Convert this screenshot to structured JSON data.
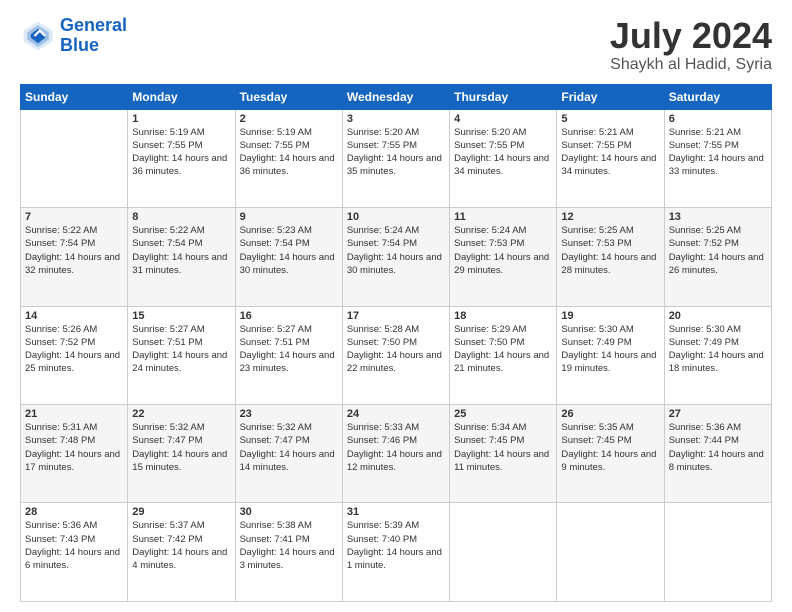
{
  "header": {
    "logo_line1": "General",
    "logo_line2": "Blue",
    "main_title": "July 2024",
    "subtitle": "Shaykh al Hadid, Syria"
  },
  "calendar": {
    "headers": [
      "Sunday",
      "Monday",
      "Tuesday",
      "Wednesday",
      "Thursday",
      "Friday",
      "Saturday"
    ],
    "weeks": [
      [
        {
          "day": "",
          "sunrise": "",
          "sunset": "",
          "daylight": ""
        },
        {
          "day": "1",
          "sunrise": "Sunrise: 5:19 AM",
          "sunset": "Sunset: 7:55 PM",
          "daylight": "Daylight: 14 hours and 36 minutes."
        },
        {
          "day": "2",
          "sunrise": "Sunrise: 5:19 AM",
          "sunset": "Sunset: 7:55 PM",
          "daylight": "Daylight: 14 hours and 36 minutes."
        },
        {
          "day": "3",
          "sunrise": "Sunrise: 5:20 AM",
          "sunset": "Sunset: 7:55 PM",
          "daylight": "Daylight: 14 hours and 35 minutes."
        },
        {
          "day": "4",
          "sunrise": "Sunrise: 5:20 AM",
          "sunset": "Sunset: 7:55 PM",
          "daylight": "Daylight: 14 hours and 34 minutes."
        },
        {
          "day": "5",
          "sunrise": "Sunrise: 5:21 AM",
          "sunset": "Sunset: 7:55 PM",
          "daylight": "Daylight: 14 hours and 34 minutes."
        },
        {
          "day": "6",
          "sunrise": "Sunrise: 5:21 AM",
          "sunset": "Sunset: 7:55 PM",
          "daylight": "Daylight: 14 hours and 33 minutes."
        }
      ],
      [
        {
          "day": "7",
          "sunrise": "Sunrise: 5:22 AM",
          "sunset": "Sunset: 7:54 PM",
          "daylight": "Daylight: 14 hours and 32 minutes."
        },
        {
          "day": "8",
          "sunrise": "Sunrise: 5:22 AM",
          "sunset": "Sunset: 7:54 PM",
          "daylight": "Daylight: 14 hours and 31 minutes."
        },
        {
          "day": "9",
          "sunrise": "Sunrise: 5:23 AM",
          "sunset": "Sunset: 7:54 PM",
          "daylight": "Daylight: 14 hours and 30 minutes."
        },
        {
          "day": "10",
          "sunrise": "Sunrise: 5:24 AM",
          "sunset": "Sunset: 7:54 PM",
          "daylight": "Daylight: 14 hours and 30 minutes."
        },
        {
          "day": "11",
          "sunrise": "Sunrise: 5:24 AM",
          "sunset": "Sunset: 7:53 PM",
          "daylight": "Daylight: 14 hours and 29 minutes."
        },
        {
          "day": "12",
          "sunrise": "Sunrise: 5:25 AM",
          "sunset": "Sunset: 7:53 PM",
          "daylight": "Daylight: 14 hours and 28 minutes."
        },
        {
          "day": "13",
          "sunrise": "Sunrise: 5:25 AM",
          "sunset": "Sunset: 7:52 PM",
          "daylight": "Daylight: 14 hours and 26 minutes."
        }
      ],
      [
        {
          "day": "14",
          "sunrise": "Sunrise: 5:26 AM",
          "sunset": "Sunset: 7:52 PM",
          "daylight": "Daylight: 14 hours and 25 minutes."
        },
        {
          "day": "15",
          "sunrise": "Sunrise: 5:27 AM",
          "sunset": "Sunset: 7:51 PM",
          "daylight": "Daylight: 14 hours and 24 minutes."
        },
        {
          "day": "16",
          "sunrise": "Sunrise: 5:27 AM",
          "sunset": "Sunset: 7:51 PM",
          "daylight": "Daylight: 14 hours and 23 minutes."
        },
        {
          "day": "17",
          "sunrise": "Sunrise: 5:28 AM",
          "sunset": "Sunset: 7:50 PM",
          "daylight": "Daylight: 14 hours and 22 minutes."
        },
        {
          "day": "18",
          "sunrise": "Sunrise: 5:29 AM",
          "sunset": "Sunset: 7:50 PM",
          "daylight": "Daylight: 14 hours and 21 minutes."
        },
        {
          "day": "19",
          "sunrise": "Sunrise: 5:30 AM",
          "sunset": "Sunset: 7:49 PM",
          "daylight": "Daylight: 14 hours and 19 minutes."
        },
        {
          "day": "20",
          "sunrise": "Sunrise: 5:30 AM",
          "sunset": "Sunset: 7:49 PM",
          "daylight": "Daylight: 14 hours and 18 minutes."
        }
      ],
      [
        {
          "day": "21",
          "sunrise": "Sunrise: 5:31 AM",
          "sunset": "Sunset: 7:48 PM",
          "daylight": "Daylight: 14 hours and 17 minutes."
        },
        {
          "day": "22",
          "sunrise": "Sunrise: 5:32 AM",
          "sunset": "Sunset: 7:47 PM",
          "daylight": "Daylight: 14 hours and 15 minutes."
        },
        {
          "day": "23",
          "sunrise": "Sunrise: 5:32 AM",
          "sunset": "Sunset: 7:47 PM",
          "daylight": "Daylight: 14 hours and 14 minutes."
        },
        {
          "day": "24",
          "sunrise": "Sunrise: 5:33 AM",
          "sunset": "Sunset: 7:46 PM",
          "daylight": "Daylight: 14 hours and 12 minutes."
        },
        {
          "day": "25",
          "sunrise": "Sunrise: 5:34 AM",
          "sunset": "Sunset: 7:45 PM",
          "daylight": "Daylight: 14 hours and 11 minutes."
        },
        {
          "day": "26",
          "sunrise": "Sunrise: 5:35 AM",
          "sunset": "Sunset: 7:45 PM",
          "daylight": "Daylight: 14 hours and 9 minutes."
        },
        {
          "day": "27",
          "sunrise": "Sunrise: 5:36 AM",
          "sunset": "Sunset: 7:44 PM",
          "daylight": "Daylight: 14 hours and 8 minutes."
        }
      ],
      [
        {
          "day": "28",
          "sunrise": "Sunrise: 5:36 AM",
          "sunset": "Sunset: 7:43 PM",
          "daylight": "Daylight: 14 hours and 6 minutes."
        },
        {
          "day": "29",
          "sunrise": "Sunrise: 5:37 AM",
          "sunset": "Sunset: 7:42 PM",
          "daylight": "Daylight: 14 hours and 4 minutes."
        },
        {
          "day": "30",
          "sunrise": "Sunrise: 5:38 AM",
          "sunset": "Sunset: 7:41 PM",
          "daylight": "Daylight: 14 hours and 3 minutes."
        },
        {
          "day": "31",
          "sunrise": "Sunrise: 5:39 AM",
          "sunset": "Sunset: 7:40 PM",
          "daylight": "Daylight: 14 hours and 1 minute."
        },
        {
          "day": "",
          "sunrise": "",
          "sunset": "",
          "daylight": ""
        },
        {
          "day": "",
          "sunrise": "",
          "sunset": "",
          "daylight": ""
        },
        {
          "day": "",
          "sunrise": "",
          "sunset": "",
          "daylight": ""
        }
      ]
    ]
  }
}
